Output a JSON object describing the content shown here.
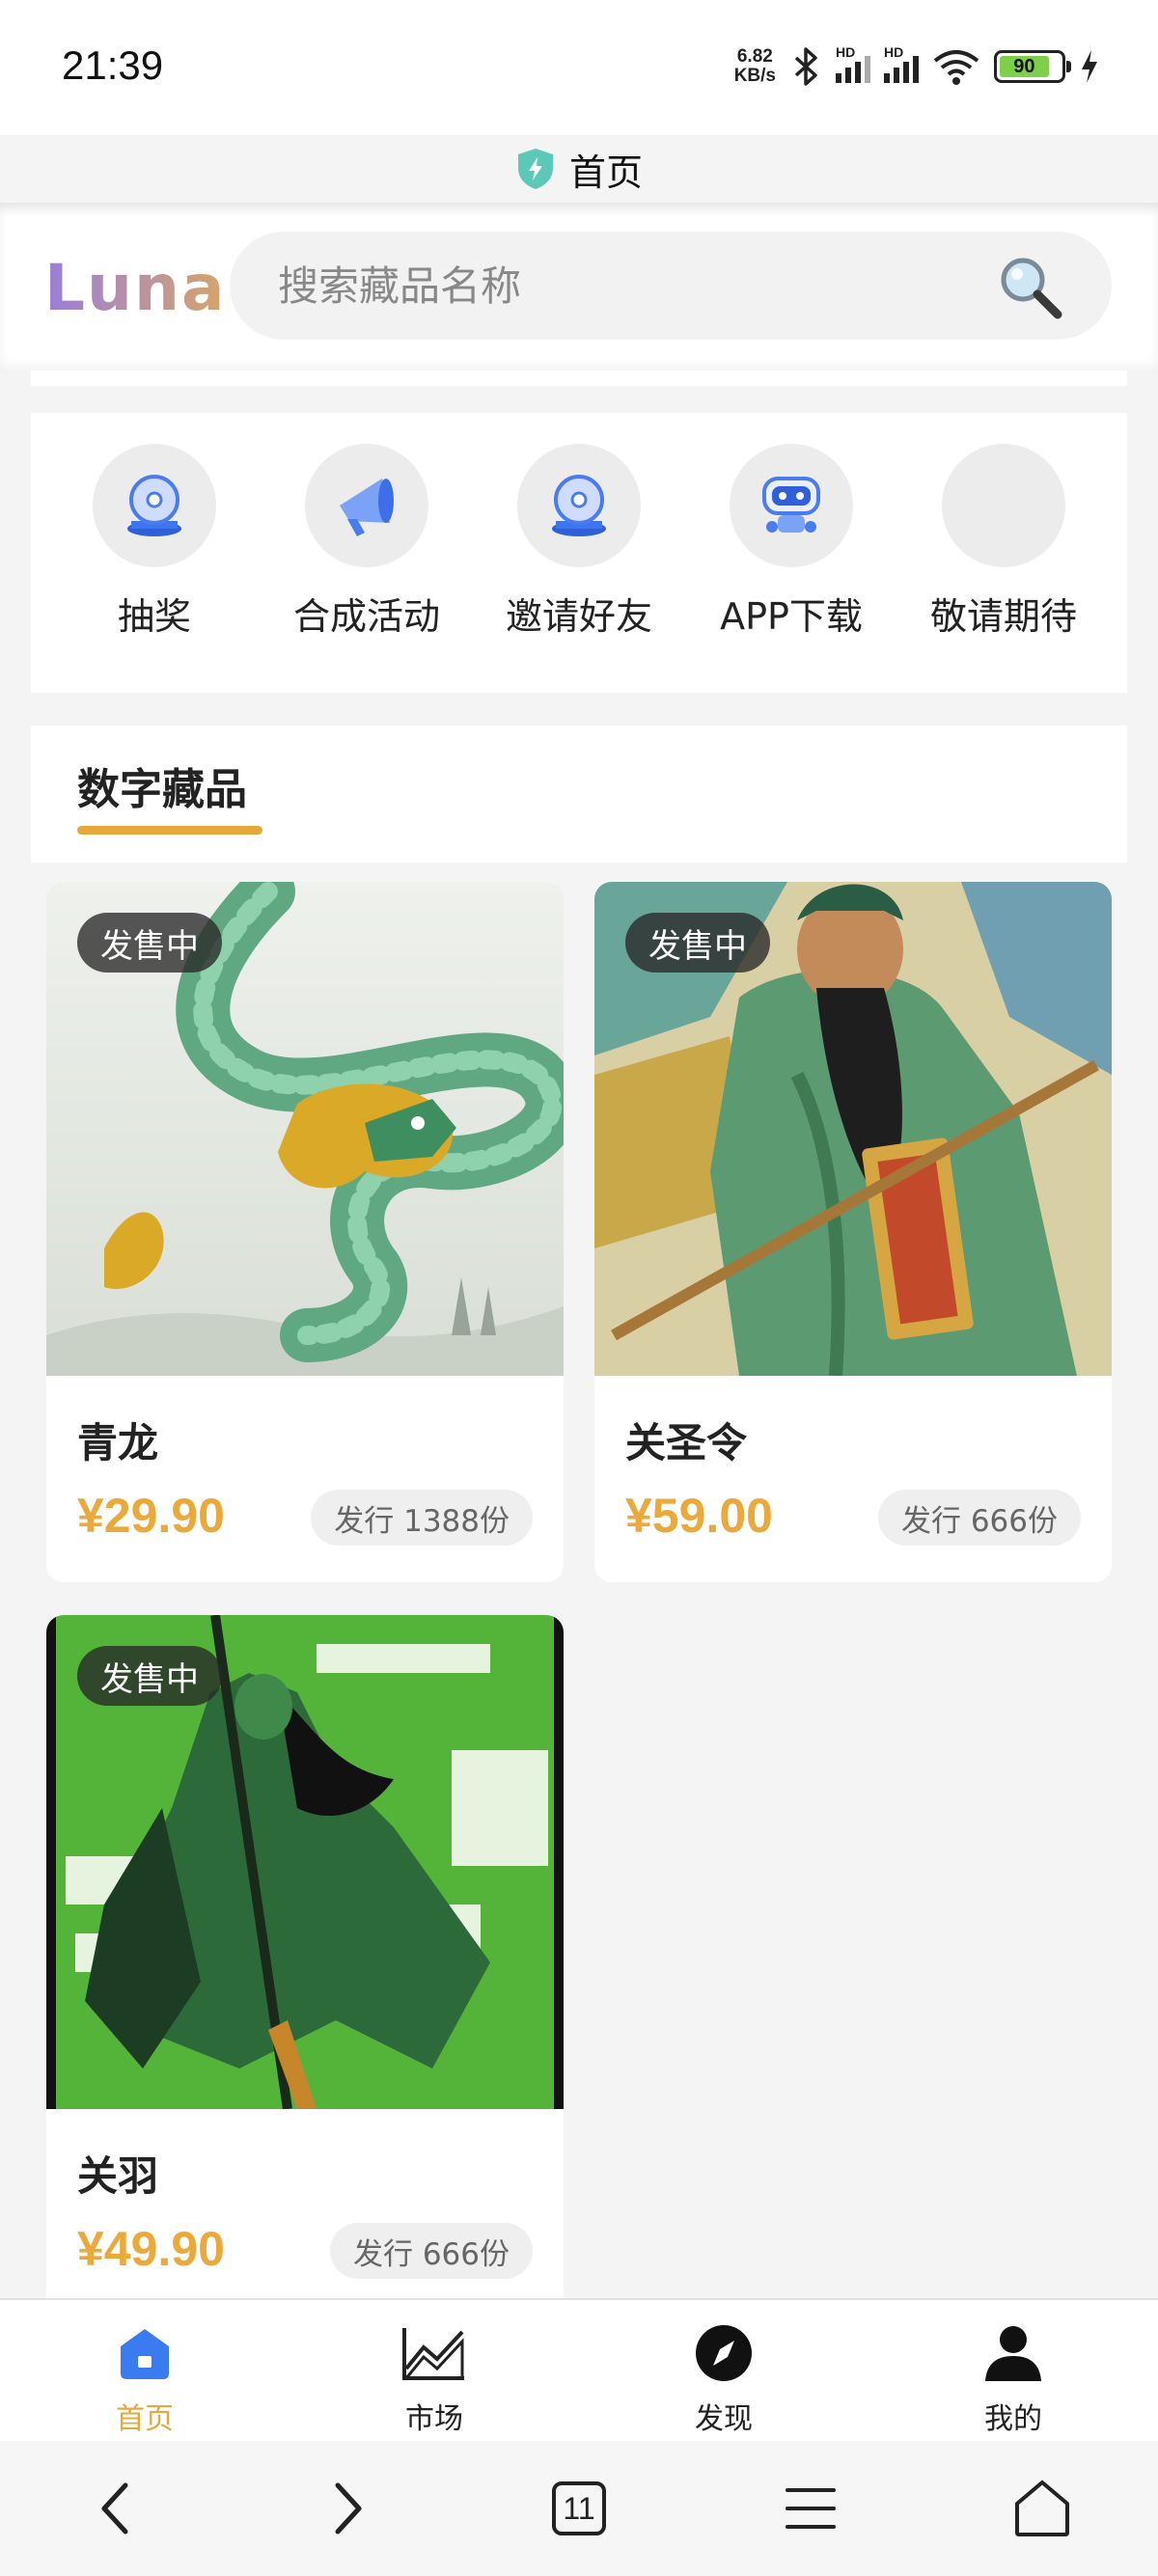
{
  "status_bar": {
    "time": "21:39",
    "net_speed_value": "6.82",
    "net_speed_unit": "KB/s",
    "sim1_label": "HD",
    "sim2_label": "HD",
    "battery": "90"
  },
  "browser": {
    "page_title": "首页"
  },
  "header": {
    "logo": "Luna",
    "search_placeholder": "搜索藏品名称"
  },
  "quick_menu": [
    {
      "label": "抽奖",
      "icon": "lottery-disc-icon"
    },
    {
      "label": "合成活动",
      "icon": "megaphone-icon"
    },
    {
      "label": "邀请好友",
      "icon": "invite-disc-icon"
    },
    {
      "label": "APP下载",
      "icon": "robot-icon"
    },
    {
      "label": "敬请期待",
      "icon": "placeholder-icon"
    }
  ],
  "section": {
    "title": "数字藏品"
  },
  "cards": [
    {
      "status": "发售中",
      "name": "青龙",
      "price": "¥29.90",
      "issue": "发行 1388份"
    },
    {
      "status": "发售中",
      "name": "关圣令",
      "price": "¥59.00",
      "issue": "发行 666份"
    },
    {
      "status": "发售中",
      "name": "关羽",
      "price": "¥49.90",
      "issue": "发行 666份"
    }
  ],
  "tabbar": [
    {
      "label": "首页",
      "icon": "home-icon",
      "active": true
    },
    {
      "label": "市场",
      "icon": "chart-icon",
      "active": false
    },
    {
      "label": "发现",
      "icon": "compass-icon",
      "active": false
    },
    {
      "label": "我的",
      "icon": "user-icon",
      "active": false
    }
  ],
  "system_nav": {
    "tabs_count": "11"
  },
  "colors": {
    "accent": "#e6a837",
    "home_tab_icon": "#3b7bf0",
    "battery_fill": "#7ed04a"
  }
}
